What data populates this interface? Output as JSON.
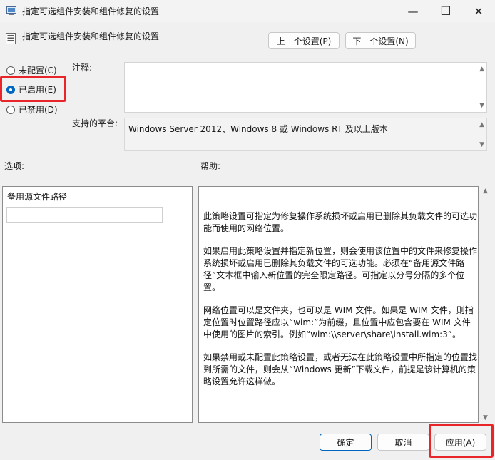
{
  "window": {
    "title": "指定可选组件安装和组件修复的设置",
    "minimize_glyph": "—",
    "maximize_glyph": "☐",
    "close_glyph": "✕"
  },
  "header": {
    "policy_title": "指定可选组件安装和组件修复的设置",
    "prev_label": "上一个设置(P)",
    "next_label": "下一个设置(N)"
  },
  "state": {
    "not_configured": "未配置(C)",
    "enabled": "已启用(E)",
    "disabled": "已禁用(D)",
    "selected": "enabled"
  },
  "comment": {
    "label": "注释:",
    "value": ""
  },
  "platform": {
    "label": "支持的平台:",
    "value": "Windows Server 2012、Windows 8 或 Windows RT 及以上版本"
  },
  "options": {
    "label": "选项:",
    "field_label": "备用源文件路径",
    "field_value": ""
  },
  "help": {
    "label": "帮助:",
    "paragraphs": [
      "此策略设置可指定为修复操作系统损坏或启用已删除其负载文件的可选功能而使用的网络位置。",
      "如果启用此策略设置并指定新位置，则会使用该位置中的文件来修复操作系统损坏或启用已删除其负载文件的可选功能。必须在“备用源文件路径”文本框中输入新位置的完全限定路径。可指定以分号分隔的多个位置。",
      "网络位置可以是文件夹，也可以是 WIM 文件。如果是 WIM 文件，则指定位置时位置路径应以“wim:”为前缀，且位置中应包含要在 WIM 文件中使用的图片的索引。例如“wim:\\\\server\\share\\install.wim:3”。",
      "如果禁用或未配置此策略设置，或者无法在此策略设置中所指定的位置找到所需的文件，则会从“Windows 更新”下载文件，前提是该计算机的策略设置允许这样做。"
    ]
  },
  "footer": {
    "ok_label": "确定",
    "cancel_label": "取消",
    "apply_label": "应用(A)"
  },
  "colors": {
    "accent": "#0067c0",
    "highlight": "#e8262a"
  },
  "icons": {
    "window": "policy-icon",
    "header": "setting-icon"
  }
}
